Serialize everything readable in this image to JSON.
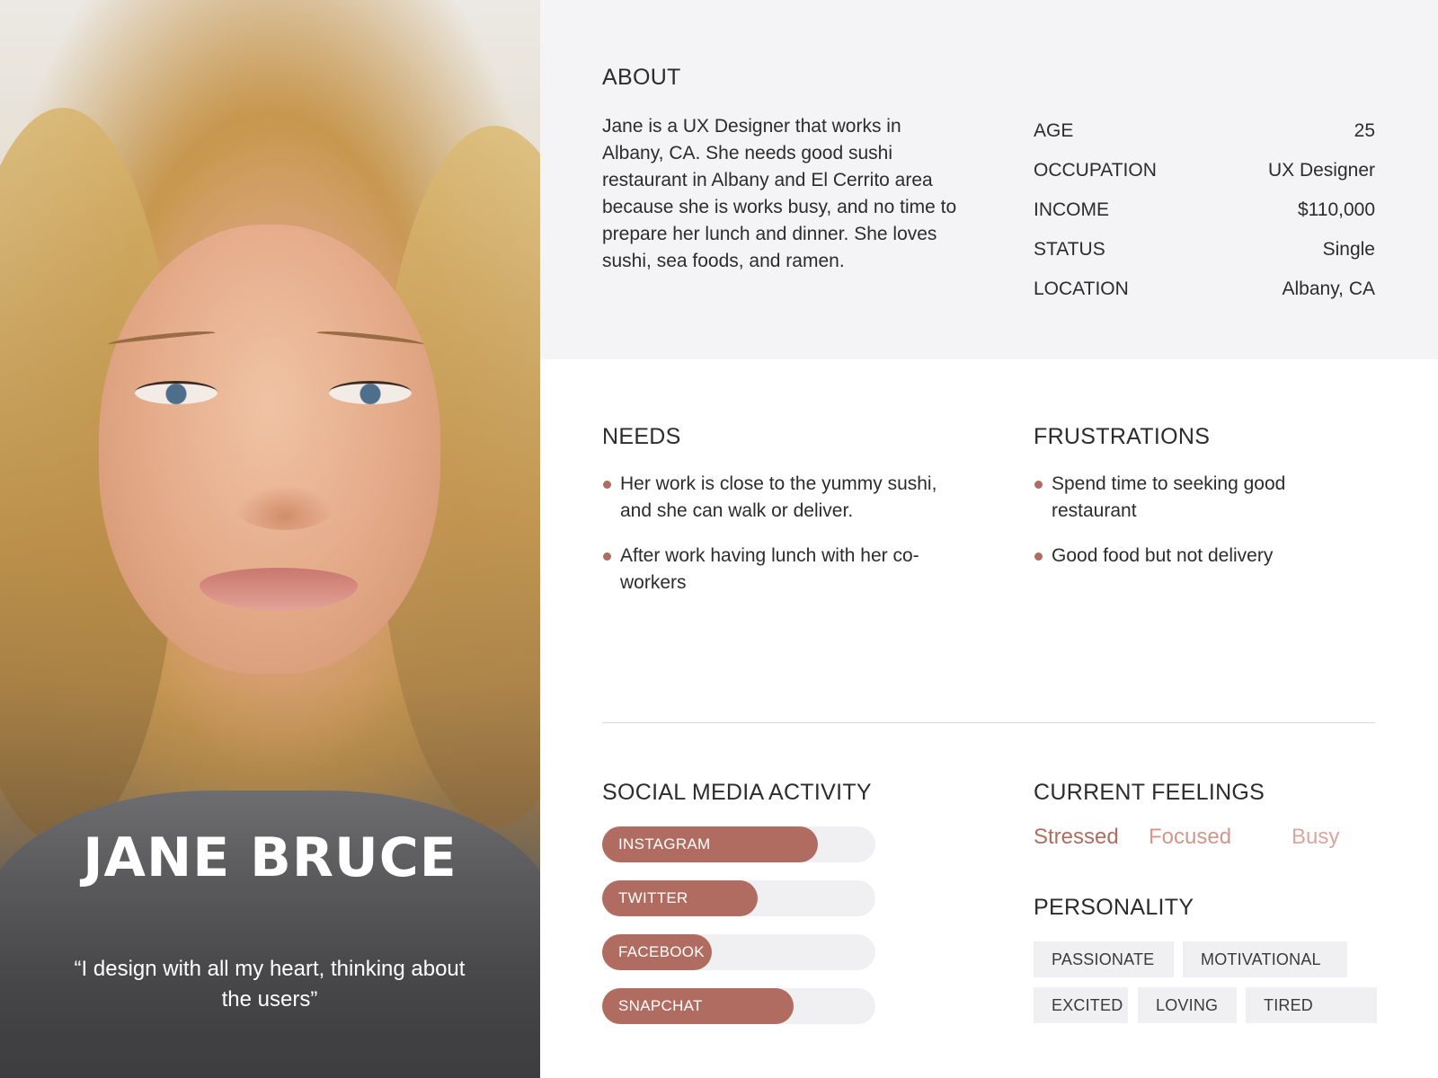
{
  "person": {
    "name": "JANE BRUCE",
    "quote": "“I design with all my heart, thinking about the users”"
  },
  "about": {
    "heading": "ABOUT",
    "text": "Jane is a UX Designer that works in Albany, CA. She needs good sushi restaurant in Albany and El Cerrito area because she is works busy, and no time to prepare her lunch and dinner. She loves sushi, sea foods, and ramen."
  },
  "facts": [
    {
      "label": "AGE",
      "value": "25"
    },
    {
      "label": "OCCUPATION",
      "value": "UX Designer"
    },
    {
      "label": "INCOME",
      "value": "$110,000"
    },
    {
      "label": "STATUS",
      "value": "Single"
    },
    {
      "label": "LOCATION",
      "value": "Albany, CA"
    }
  ],
  "needs": {
    "heading": "NEEDS",
    "items": [
      "Her work is close to the yummy sushi, and she can walk or deliver.",
      "After work having lunch with her co-workers"
    ]
  },
  "frustrations": {
    "heading": "FRUSTRATIONS",
    "items": [
      "Spend time to seeking good restaurant",
      "Good food but not delivery"
    ]
  },
  "social": {
    "heading": "SOCIAL MEDIA ACTIVITY",
    "items": [
      {
        "label": "INSTAGRAM",
        "level": 0.79
      },
      {
        "label": "TWITTER",
        "level": 0.57
      },
      {
        "label": "FACEBOOK",
        "level": 0.4
      },
      {
        "label": "SNAPCHAT",
        "level": 0.7
      }
    ]
  },
  "feelings": {
    "heading": "CURRENT FEELINGS",
    "items": [
      {
        "label": "Stressed",
        "color": "#b06c60"
      },
      {
        "label": "Focused",
        "color": "#d2968b"
      },
      {
        "label": "Busy",
        "color": "#dba59c"
      }
    ]
  },
  "personality": {
    "heading": "PERSONALITY",
    "tags": [
      "PASSIONATE",
      "MOTIVATIONAL",
      "EXCITED",
      "LOVING",
      "TIRED"
    ]
  },
  "colors": {
    "accent": "#b06c60",
    "band": "#f4f4f6",
    "track": "#f0f0f2"
  }
}
